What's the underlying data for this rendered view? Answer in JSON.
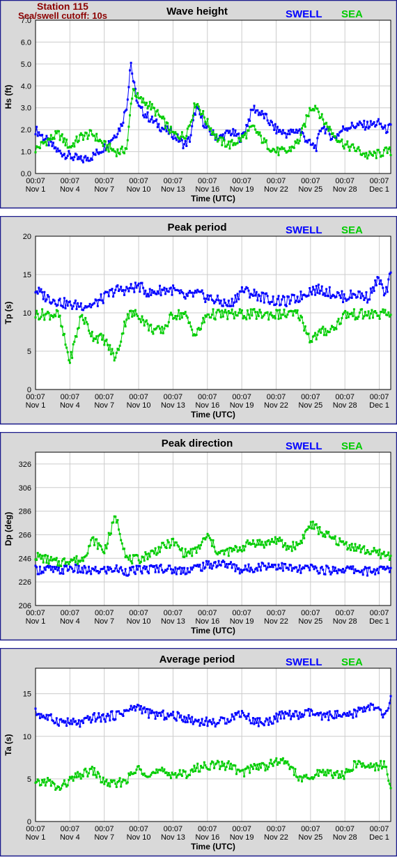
{
  "header": {
    "station_label": "Station 115",
    "cutoff_label": "Sea/swell cutoff: 10s"
  },
  "legend": {
    "swell_label": "SWELL",
    "sea_label": "SEA",
    "swell_color": "#0000ff",
    "sea_color": "#00cc00"
  },
  "colors": {
    "frame": "#1a1a8c",
    "panel_bg": "#d9d9d9",
    "plot_bg": "#ffffff",
    "grid": "#cccccc"
  },
  "x_axis": {
    "label": "Time (UTC)",
    "start_date": "Nov 1",
    "tick_time": "00:07",
    "tick_dates": [
      "Nov 1",
      "Nov 4",
      "Nov 7",
      "Nov 10",
      "Nov 13",
      "Nov 16",
      "Nov 19",
      "Nov 22",
      "Nov 25",
      "Nov 28",
      "Dec 1"
    ]
  },
  "chart_data": [
    {
      "type": "line",
      "title": "Wave height",
      "ylabel": "Hs (ft)",
      "ylim": [
        0,
        7
      ],
      "yticks": [
        "0.0",
        "1.0",
        "2.0",
        "3.0",
        "4.0",
        "5.0",
        "6.0",
        "7.0"
      ],
      "grid": true,
      "legend_position": "top-right",
      "x_day": [
        0,
        1,
        2,
        3,
        4,
        5,
        6,
        7,
        7.5,
        8,
        8.3,
        8.5,
        9,
        10,
        11,
        12,
        13,
        13.5,
        14,
        15,
        16,
        17,
        18,
        19,
        20,
        21,
        22,
        23,
        24,
        24.5,
        25,
        26,
        27,
        28,
        29,
        30,
        30.5,
        31
      ],
      "series": [
        {
          "name": "SWELL",
          "values": [
            2.0,
            1.5,
            1.0,
            0.8,
            0.6,
            0.8,
            1.2,
            1.8,
            2.2,
            3.2,
            5.2,
            4.3,
            3.0,
            2.5,
            2.1,
            1.8,
            1.3,
            1.6,
            3.0,
            2.0,
            1.6,
            1.9,
            1.6,
            3.0,
            2.6,
            2.0,
            1.8,
            2.0,
            1.3,
            1.2,
            2.2,
            1.6,
            2.1,
            2.2,
            2.2,
            2.3,
            2.0,
            2.1
          ]
        },
        {
          "name": "SEA",
          "values": [
            1.1,
            1.5,
            1.8,
            1.2,
            1.7,
            1.8,
            1.3,
            1.0,
            1.0,
            1.2,
            3.0,
            3.9,
            3.4,
            3.1,
            2.5,
            1.8,
            1.7,
            2.3,
            3.3,
            2.3,
            1.5,
            1.3,
            1.6,
            2.1,
            1.4,
            1.0,
            1.0,
            1.5,
            3.0,
            3.1,
            2.5,
            1.8,
            1.3,
            1.1,
            0.8,
            0.9,
            1.0,
            1.0
          ]
        }
      ]
    },
    {
      "type": "line",
      "title": "Peak period",
      "ylabel": "Tp (s)",
      "ylim": [
        0,
        20
      ],
      "yticks": [
        "0",
        "5",
        "10",
        "15",
        "20"
      ],
      "grid": true,
      "legend_position": "top-right",
      "x_day": [
        0,
        1,
        2,
        3,
        4,
        5,
        6,
        7,
        8,
        9,
        10,
        11,
        12,
        13,
        14,
        15,
        16,
        17,
        18,
        19,
        20,
        21,
        22,
        23,
        24,
        25,
        26,
        27,
        28,
        29,
        30,
        30.5,
        31
      ],
      "series": [
        {
          "name": "SWELL",
          "values": [
            13,
            12,
            11.5,
            11,
            11,
            11,
            12,
            13,
            13,
            13.5,
            12.5,
            13,
            13,
            12,
            12.5,
            12,
            11.5,
            11,
            13,
            12.5,
            12,
            11.5,
            11.5,
            12,
            13,
            13,
            12.5,
            12,
            12.5,
            12,
            14.5,
            12,
            15
          ]
        },
        {
          "name": "SEA",
          "values": [
            9.8,
            9.8,
            9.8,
            3.6,
            9.8,
            7.0,
            6.5,
            4.0,
            9.8,
            9.8,
            8.0,
            7.5,
            9.8,
            9.8,
            7.0,
            9.8,
            9.8,
            9.8,
            9.8,
            9.8,
            9.8,
            9.8,
            9.8,
            9.8,
            6.5,
            7.5,
            8.0,
            9.8,
            9.8,
            9.8,
            9.8,
            9.8,
            9.8
          ]
        }
      ]
    },
    {
      "type": "line",
      "title": "Peak direction",
      "ylabel": "Dp (deg)",
      "ylim": [
        206,
        336
      ],
      "yticks": [
        "206",
        "226",
        "246",
        "266",
        "286",
        "306",
        "326"
      ],
      "grid": true,
      "legend_position": "top-right",
      "x_day": [
        0,
        1,
        2,
        3,
        4,
        5,
        6,
        7,
        8,
        9,
        10,
        11,
        12,
        13,
        14,
        15,
        16,
        17,
        18,
        19,
        20,
        21,
        22,
        23,
        24,
        25,
        26,
        27,
        28,
        29,
        30,
        31
      ],
      "series": [
        {
          "name": "SWELL",
          "values": [
            236,
            237,
            235,
            238,
            236,
            235,
            236,
            237,
            235,
            236,
            237,
            238,
            236,
            236,
            238,
            240,
            242,
            240,
            236,
            238,
            240,
            240,
            238,
            236,
            238,
            236,
            236,
            237,
            236,
            235,
            236,
            237
          ]
        },
        {
          "name": "SEA",
          "values": [
            248,
            245,
            242,
            245,
            244,
            262,
            252,
            282,
            245,
            245,
            250,
            255,
            260,
            250,
            252,
            265,
            250,
            252,
            255,
            260,
            258,
            262,
            255,
            258,
            275,
            268,
            262,
            258,
            255,
            252,
            250,
            248
          ]
        }
      ]
    },
    {
      "type": "line",
      "title": "Average period",
      "ylabel": "Ta (s)",
      "ylim": [
        0,
        18
      ],
      "yticks": [
        "0",
        "5",
        "10",
        "15"
      ],
      "grid": true,
      "legend_position": "top-right",
      "x_day": [
        0,
        1,
        2,
        3,
        4,
        5,
        6,
        7,
        8,
        9,
        10,
        11,
        12,
        13,
        14,
        15,
        16,
        17,
        18,
        19,
        20,
        21,
        22,
        23,
        24,
        25,
        26,
        27,
        28,
        29,
        30,
        30.5,
        31
      ],
      "series": [
        {
          "name": "SWELL",
          "values": [
            12.8,
            12.2,
            11.8,
            11.6,
            11.5,
            12.2,
            12.2,
            12.5,
            13.0,
            13.5,
            12.6,
            12.5,
            12.4,
            12.2,
            11.8,
            11.7,
            11.6,
            12.2,
            12.8,
            11.8,
            11.6,
            12.2,
            12.6,
            12.4,
            12.8,
            12.2,
            12.6,
            12.2,
            12.8,
            13.6,
            13.0,
            12.2,
            14.5
          ]
        },
        {
          "name": "SEA",
          "values": [
            4.3,
            4.8,
            3.8,
            4.8,
            5.5,
            6.0,
            4.6,
            4.3,
            5.0,
            6.2,
            5.6,
            5.8,
            5.6,
            5.5,
            6.2,
            6.6,
            6.6,
            6.6,
            5.6,
            6.5,
            6.5,
            7.0,
            7.0,
            5.0,
            5.0,
            6.0,
            5.5,
            5.5,
            6.8,
            6.5,
            6.5,
            7.0,
            3.5
          ]
        }
      ]
    }
  ]
}
